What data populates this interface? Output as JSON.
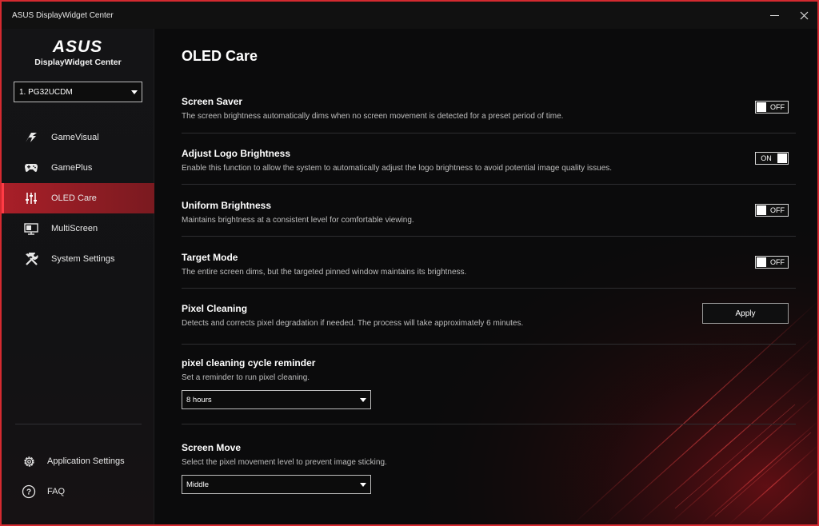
{
  "window": {
    "title": "ASUS DisplayWidget Center",
    "accent_color": "#d42a30",
    "active_nav_color": "#a81f28"
  },
  "sidebar": {
    "brand_name": "DisplayWidget Center",
    "logo_text": "ASUS",
    "monitor_selected": "1. PG32UCDM",
    "nav_items": [
      {
        "label": "GameVisual",
        "icon": "gamevisual-icon"
      },
      {
        "label": "GamePlus",
        "icon": "gamepad-icon"
      },
      {
        "label": "OLED Care",
        "icon": "sliders-icon",
        "active": true
      },
      {
        "label": "MultiScreen",
        "icon": "monitor-icon"
      },
      {
        "label": "System Settings",
        "icon": "tools-icon"
      }
    ],
    "bottom_items": [
      {
        "label": "Application Settings",
        "icon": "gear-icon"
      },
      {
        "label": "FAQ",
        "icon": "question-icon"
      }
    ]
  },
  "main": {
    "title": "OLED Care",
    "settings": [
      {
        "name": "Screen Saver",
        "description": "The screen brightness automatically dims when no screen movement is detected for a preset period of time.",
        "toggle": "OFF"
      },
      {
        "name": "Adjust Logo Brightness",
        "description": "Enable this function to allow the system to automatically adjust the logo brightness to avoid potential image quality issues.",
        "toggle": "ON"
      },
      {
        "name": "Uniform Brightness",
        "description": "Maintains brightness at a consistent level for comfortable viewing.",
        "toggle": "OFF"
      },
      {
        "name": "Target Mode",
        "description": "The entire screen dims, but the targeted pinned window maintains its brightness.",
        "toggle": "OFF"
      },
      {
        "name": "Pixel Cleaning",
        "description": "Detects and corrects pixel degradation if needed. The process will take approximately 6 minutes.",
        "button": "Apply"
      },
      {
        "name": "pixel cleaning cycle reminder",
        "description": "Set a reminder to run pixel cleaning.",
        "select": "8 hours"
      },
      {
        "name": "Screen Move",
        "description": "Select the pixel movement level to prevent image sticking.",
        "select": "Middle"
      }
    ]
  }
}
